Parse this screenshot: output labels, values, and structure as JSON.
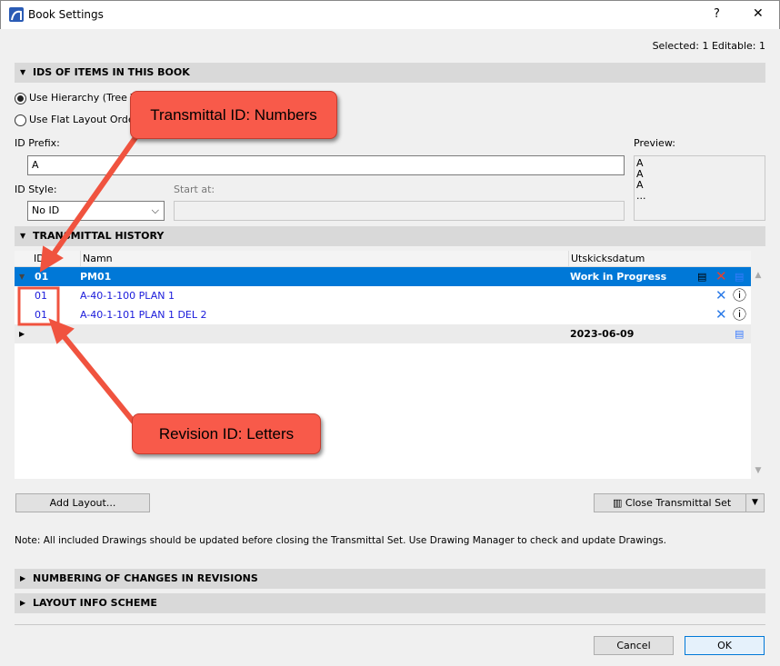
{
  "window": {
    "title": "Book Settings",
    "help": "?",
    "close": "✕"
  },
  "status": "Selected: 1 Editable: 1",
  "ids_section": {
    "title": "IDS OF ITEMS IN THIS BOOK",
    "radio_hierarchy": "Use Hierarchy (Tree Vi",
    "radio_flat": "Use Flat Layout Orde",
    "id_prefix_label": "ID Prefix:",
    "id_prefix_value": "A",
    "preview_label": "Preview:",
    "preview_lines": [
      "A",
      "A",
      "A",
      "..."
    ],
    "id_style_label": "ID Style:",
    "id_style_value": "No ID",
    "start_at_label": "Start at:"
  },
  "history": {
    "title": "TRANSMITTAL HISTORY",
    "columns": [
      "ID",
      "Namn",
      "Utskicksdatum"
    ],
    "rows": [
      {
        "id": "01",
        "name": "PM01",
        "date": "Work in Progress"
      },
      {
        "id": "01",
        "name": "A-40-1-100 PLAN 1",
        "date": ""
      },
      {
        "id": "01",
        "name": "A-40-1-101 PLAN 1 DEL 2",
        "date": ""
      },
      {
        "id": "",
        "name": "",
        "date": "2023-06-09"
      }
    ]
  },
  "buttons": {
    "add_layout": "Add Layout...",
    "close_set": "Close Transmittal Set",
    "cancel": "Cancel",
    "ok": "OK"
  },
  "note": "Note: All included Drawings should be updated before closing the Transmittal Set. Use Drawing Manager to check and update Drawings.",
  "sections": {
    "numbering": "NUMBERING OF CHANGES IN REVISIONS",
    "layout_info": "LAYOUT INFO SCHEME"
  },
  "annotations": {
    "callout1": "Transmittal ID: Numbers",
    "callout2": "Revision ID: Letters"
  },
  "colors": {
    "selection": "#0078d7",
    "link": "#1a1adb",
    "callout": "#f85a4a"
  }
}
